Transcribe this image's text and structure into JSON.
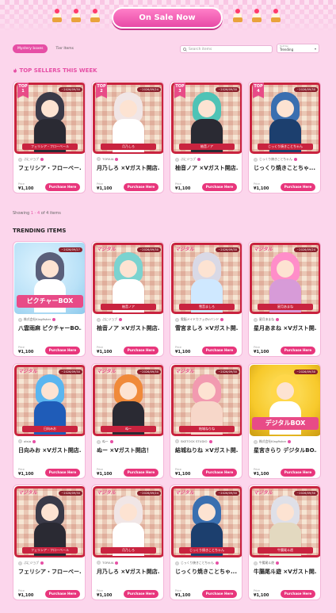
{
  "banner": {
    "sale_label": "On Sale Now"
  },
  "tabs": [
    {
      "label": "Mystery boxes"
    },
    {
      "label": "Tier Items"
    }
  ],
  "search": {
    "placeholder": "Search items"
  },
  "sort": {
    "label": "Sort by",
    "value": "Trending"
  },
  "top_sellers": {
    "title": "TOP SELLERS THIS WEEK",
    "items": [
      {
        "rank_label": "TOP",
        "rank": "1",
        "date": "~2026/09/30",
        "ribbon": "フェリシア・フローベール",
        "seller": "ぷにジョブ",
        "title": "フェリシア・フローベー...",
        "price_label": "Price",
        "price": "¥1,100",
        "buy": "Purchase Here"
      },
      {
        "rank_label": "TOP",
        "rank": "2",
        "date": "~2026/09/24",
        "ribbon": "月乃しろ",
        "seller": "TORIUA",
        "title": "月乃しろ ×Vガスト開店...",
        "price_label": "Price",
        "price": "¥1,100",
        "buy": "Purchase Here"
      },
      {
        "rank_label": "TOP",
        "rank": "3",
        "date": "~2026/09/30",
        "ribbon": "柚音ノア",
        "seller": "ぷにジョブ",
        "title": "柚音ノア ×Vガスト開店...",
        "price_label": "Price",
        "price": "¥1,100",
        "buy": "Purchase Here"
      },
      {
        "rank_label": "TOP",
        "rank": "4",
        "date": "~2026/09/30",
        "ribbon": "じっくり焼きことちゃん",
        "seller": "じっくり焼きことちゃん",
        "title": "じっくり焼きことちゃ...",
        "price_label": "Price",
        "price": "¥1,100",
        "buy": "Purchase Here"
      }
    ]
  },
  "showing": {
    "prefix": "Showing ",
    "range": "1 - 4",
    "suffix": " of 4 items"
  },
  "trending": {
    "title": "TRENDING ITEMS",
    "items": [
      {
        "date": "~2026/09/27",
        "ribbon": "ピクチャーBOX",
        "seller": "株式会社Kingfisher",
        "title": "八雲雨麻 ピクチャーBO...",
        "price_label": "Price",
        "price": "¥1,100",
        "buy": "Purchase Here",
        "logo": ""
      },
      {
        "date": "~2026/09/30",
        "ribbon": "柚音ノア",
        "seller": "ぷにジョブ",
        "title": "柚音ノア ×Vガスト開店...",
        "price_label": "Price",
        "price": "¥1,100",
        "buy": "Purchase Here",
        "logo": "マジタル"
      },
      {
        "date": "~2026/09/30",
        "ribbon": "雪音ましろ",
        "seller": "電脳メイドカフェのVバンド",
        "title": "雪宮ましろ ×Vガスト開...",
        "price_label": "Price",
        "price": "¥1,100",
        "buy": "Purchase Here",
        "logo": "マジタル"
      },
      {
        "date": "~2026/09/24",
        "ribbon": "星月あまね",
        "seller": "星月あまね",
        "title": "星月あまね ×Vガスト開...",
        "price_label": "Price",
        "price": "¥1,100",
        "buy": "Purchase Here",
        "logo": "マジタル"
      },
      {
        "date": "~2026/09/30",
        "ribbon": "日向みお",
        "seller": "otsia",
        "title": "日向みお ×Vガスト開店...",
        "price_label": "Price",
        "price": "¥1,100",
        "buy": "Purchase Here",
        "logo": "マジタル"
      },
      {
        "date": "~2026/09/30",
        "ribbon": "ぬー",
        "seller": "ぬー",
        "title": "ぬー ×Vガスト開店！",
        "price_label": "Price",
        "price": "¥1,100",
        "buy": "Purchase Here",
        "logo": "マジタル"
      },
      {
        "date": "~2026/09/30",
        "ribbon": "結城ねりね",
        "seller": "SKETOCK STUDIO",
        "title": "結城ねりね ×Vガスト開...",
        "price_label": "Price",
        "price": "¥1,100",
        "buy": "Purchase Here",
        "logo": "マジタル"
      },
      {
        "date": "~2026/09/30",
        "ribbon": "デジタルBOX",
        "seller": "株式会社Kingfisher",
        "title": "星宮きらり デジタルBO...",
        "price_label": "Price",
        "price": "¥1,100",
        "buy": "Purchase Here",
        "logo": ""
      },
      {
        "date": "~2026/09/30",
        "ribbon": "フェリシア・フローベール",
        "seller": "ぷにジョブ",
        "title": "フェリシア・フローベー...",
        "price_label": "Price",
        "price": "¥1,100",
        "buy": "Purchase Here",
        "logo": "マジタル"
      },
      {
        "date": "~2026/09/24",
        "ribbon": "月乃しろ",
        "seller": "TORIUA",
        "title": "月乃しろ ×Vガスト開店...",
        "price_label": "Price",
        "price": "¥1,100",
        "buy": "Purchase Here",
        "logo": "マジタル"
      },
      {
        "date": "~2026/09/30",
        "ribbon": "じっくり焼きことちゃん",
        "seller": "じっくり焼きことちゃん",
        "title": "じっくり焼きことちゃ...",
        "price_label": "Price",
        "price": "¥1,100",
        "buy": "Purchase Here",
        "logo": "マジタル"
      },
      {
        "date": "~2026/09/30",
        "ribbon": "牛腸尾斗遊",
        "seller": "牛腸尾斗遊",
        "title": "牛腸尾斗遊 ×Vガスト開...",
        "price_label": "Price",
        "price": "¥1,100",
        "buy": "Purchase Here",
        "logo": "マジタル"
      }
    ]
  }
}
